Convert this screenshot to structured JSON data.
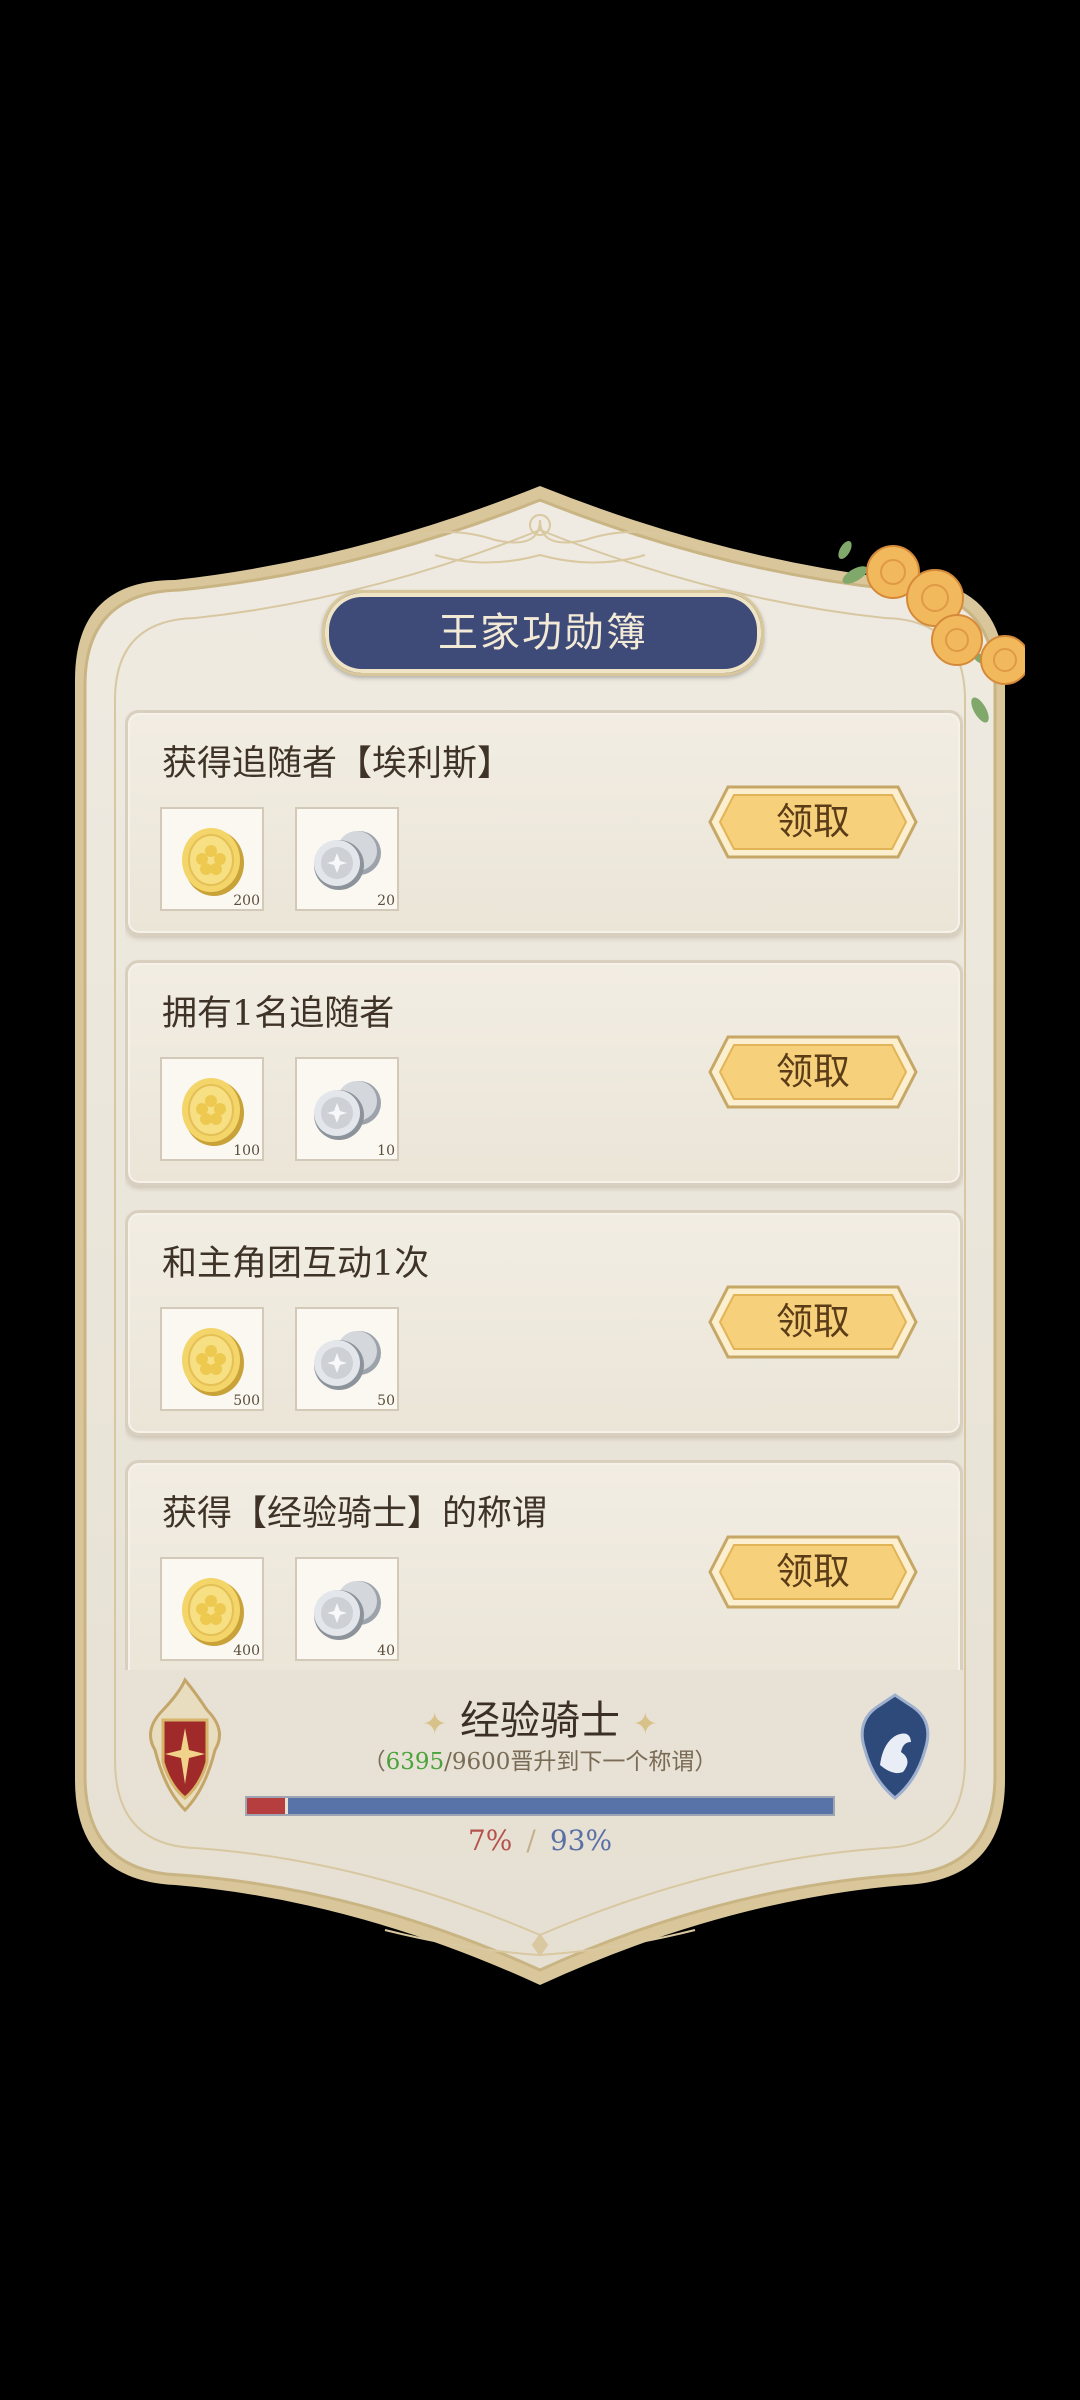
{
  "window": {
    "title": "王家功勋簿"
  },
  "tasks": [
    {
      "label": "获得追随者【埃利斯】",
      "gold_qty": "200",
      "silver_qty": "20",
      "claim_label": "领取"
    },
    {
      "label": "拥有1名追随者",
      "gold_qty": "100",
      "silver_qty": "10",
      "claim_label": "领取"
    },
    {
      "label": "和主角团互动1次",
      "gold_qty": "500",
      "silver_qty": "50",
      "claim_label": "领取"
    },
    {
      "label": "获得【经验骑士】的称谓",
      "gold_qty": "400",
      "silver_qty": "40",
      "claim_label": "领取"
    }
  ],
  "icons": {
    "gold_reward": "gold-coin-icon",
    "silver_reward": "silver-coins-icon",
    "left_emblem": "red-shield-emblem-icon",
    "right_emblem": "blue-horse-shield-icon"
  },
  "rank": {
    "title": "经验骑士",
    "current": "6395",
    "total": "9600",
    "progress_prefix": "（",
    "progress_suffix": "晋升到下一个称谓）",
    "red_percent": "7%",
    "blue_percent": "93%",
    "fraction": 0.07
  },
  "colors": {
    "title_bg": "#3e4a78",
    "button_gold": "#f6d07a",
    "progress_red": "#b73e3e",
    "progress_blue": "#5873a8",
    "current_value": "#4aa33c"
  }
}
